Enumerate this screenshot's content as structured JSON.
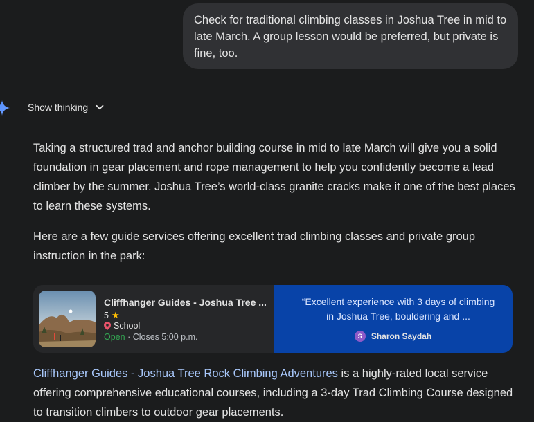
{
  "user_message": "Check for traditional climbing classes in Joshua Tree in mid to late March. A group lesson would be preferred, but private is fine, too.",
  "thinking": {
    "label": "Show thinking",
    "icon": "chevron-down-icon",
    "spark_icon": "gemini-spark-icon"
  },
  "response": {
    "paragraph1": "Taking a structured trad and anchor building course in mid to late March will give you a solid foundation in gear placement and rope management to help you confidently become a lead climber by the summer. Joshua Tree’s world-class granite cracks make it one of the best places to learn these systems.",
    "paragraph2": "Here are a few guide services offering excellent trad climbing classes and private group instruction in the park:",
    "paragraph3_link": "Cliffhanger Guides - Joshua Tree Rock Climbing Adventures",
    "paragraph3_rest": " is a highly-rated local service offering comprehensive educational courses, including a 3-day Trad Climbing Course designed to transition climbers to outdoor gear placements."
  },
  "place_card": {
    "name": "Cliffhanger Guides - Joshua Tree ...",
    "rating": "5",
    "type": "School",
    "status": "Open",
    "hours": " · Closes 5:00 p.m.",
    "review_quote": "“Excellent experience with 3 days of climbing in Joshua Tree, bouldering and ...",
    "reviewer_initial": "S",
    "reviewer_name": "Sharon Saydah",
    "colors": {
      "open": "#34a853",
      "star": "#fbbc04",
      "review_bg": "#0843a8",
      "avatar": "#8e5ac8"
    }
  }
}
